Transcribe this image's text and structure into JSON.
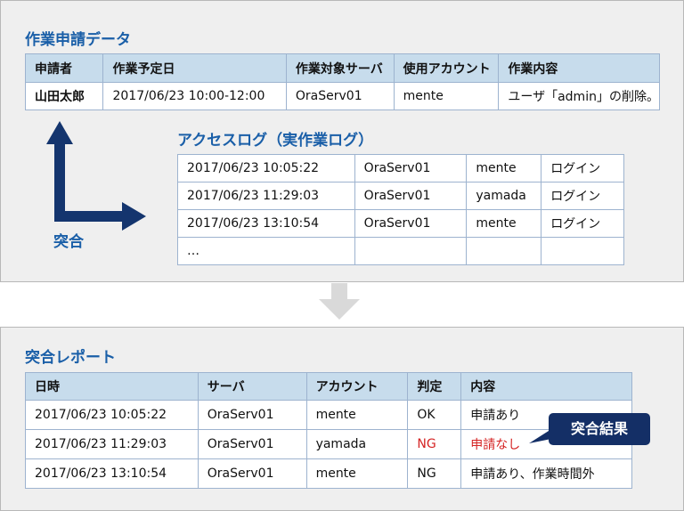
{
  "application": {
    "title": "作業申請データ",
    "headers": [
      "申請者",
      "作業予定日",
      "作業対象サーバ",
      "使用アカウント",
      "作業内容"
    ],
    "row": [
      "山田太郎",
      "2017/06/23 10:00-12:00",
      "OraServ01",
      "mente",
      "ユーザ「admin」の削除。"
    ]
  },
  "access_log": {
    "title": "アクセスログ（実作業ログ）",
    "rows": [
      [
        "2017/06/23 10:05:22",
        "OraServ01",
        "mente",
        "ログイン"
      ],
      [
        "2017/06/23 11:29:03",
        "OraServ01",
        "yamada",
        "ログイン"
      ],
      [
        "2017/06/23 13:10:54",
        "OraServ01",
        "mente",
        "ログイン"
      ],
      [
        "…",
        "",
        "",
        ""
      ]
    ]
  },
  "match_label": "突合",
  "report": {
    "title": "突合レポート",
    "headers": [
      "日時",
      "サーバ",
      "アカウント",
      "判定",
      "内容"
    ],
    "rows": [
      [
        "2017/06/23 10:05:22",
        "OraServ01",
        "mente",
        "OK",
        "申請あり"
      ],
      [
        "2017/06/23 11:29:03",
        "OraServ01",
        "yamada",
        "NG",
        "申請なし"
      ],
      [
        "2017/06/23 13:10:54",
        "OraServ01",
        "mente",
        "NG",
        "申請あり、作業時間外"
      ]
    ]
  },
  "result_callout": "突合結果",
  "colors": {
    "title": "#1a5fa8",
    "header_bg": "#c7dcec",
    "arrow": "#14356e",
    "ng": "#d52424",
    "callout": "#142f66"
  }
}
